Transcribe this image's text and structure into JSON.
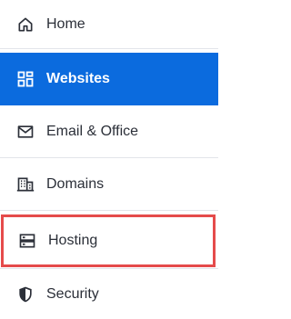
{
  "nav": {
    "items": [
      {
        "label": "Home",
        "icon": "home-icon",
        "active": false
      },
      {
        "label": "Websites",
        "icon": "websites-icon",
        "active": true
      },
      {
        "label": "Email & Office",
        "icon": "mail-icon",
        "active": false
      },
      {
        "label": "Domains",
        "icon": "domains-icon",
        "active": false
      },
      {
        "label": "Hosting",
        "icon": "hosting-icon",
        "active": false,
        "highlighted": true
      },
      {
        "label": "Security",
        "icon": "shield-icon",
        "active": false
      }
    ]
  },
  "colors": {
    "active_bg": "#0b6bde",
    "active_text": "#ffffff",
    "text": "#2b2f38",
    "highlight_border": "#e54b4b",
    "divider": "#e3e5ea"
  }
}
